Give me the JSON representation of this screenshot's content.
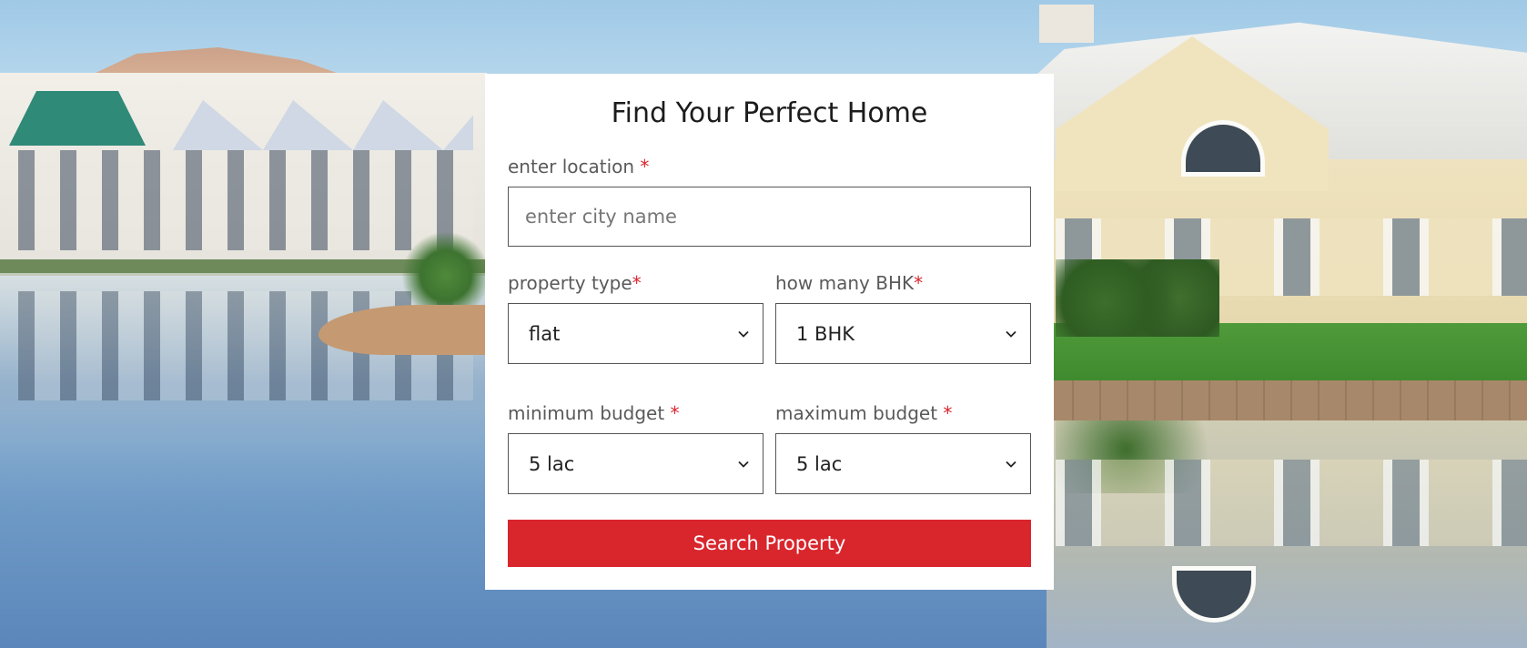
{
  "form": {
    "title": "Find Your Perfect Home",
    "location": {
      "label": "enter location ",
      "required_mark": "*",
      "placeholder": "enter city name",
      "value": ""
    },
    "property_type": {
      "label": "property type",
      "required_mark": "*",
      "selected": "flat"
    },
    "bhk": {
      "label": "how many BHK",
      "required_mark": "*",
      "selected": "1 BHK"
    },
    "min_budget": {
      "label": "minimum budget ",
      "required_mark": "*",
      "selected": "5 lac"
    },
    "max_budget": {
      "label": "maximum budget ",
      "required_mark": "*",
      "selected": "5 lac"
    },
    "submit_label": "Search Property"
  },
  "colors": {
    "accent": "#d9262d",
    "card_background": "#ffffff",
    "label_text": "#5a5a5a"
  },
  "icons": {
    "select_arrow": "chevron-down-icon"
  }
}
